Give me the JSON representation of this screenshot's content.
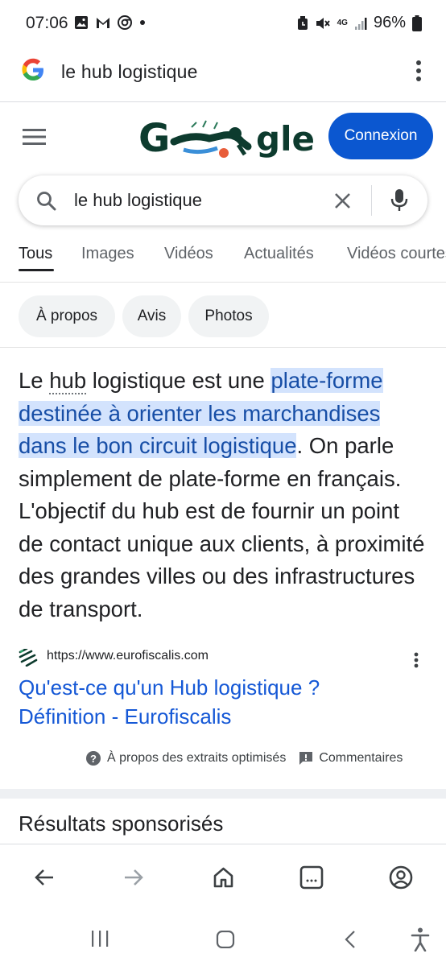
{
  "status": {
    "time": "07:06",
    "battery": "96%",
    "net": "4G"
  },
  "urlbar": {
    "query": "le hub logistique"
  },
  "header": {
    "signin_label": "Connexion",
    "logo_left": "G",
    "logo_right": "gle"
  },
  "search": {
    "value": "le hub logistique"
  },
  "tabs": [
    "Tous",
    "Images",
    "Vidéos",
    "Actualités",
    "Vidéos courtes"
  ],
  "chips": [
    "À propos",
    "Avis",
    "Photos"
  ],
  "snippet": {
    "part1": "Le ",
    "hub": "hub",
    "part2": " logistique est une ",
    "highlight1": "plate-forme",
    "highlight2": "destinée à orienter les marchandises",
    "highlight3": "dans le bon circuit logistique",
    "part3": ". On parle simplement de plate-forme en français. L'objectif du hub est de fournir un point de contact unique aux clients, à proximité des grandes villes ou des infrastructures de transport."
  },
  "source": {
    "url": "https://www.eurofiscalis.com",
    "title_line1": "Qu'est-ce qu'un Hub logistique ?",
    "title_line2": "Définition - Eurofiscalis"
  },
  "footer_links": {
    "about": "À propos des extraits optimisés",
    "feedback": "Commentaires"
  },
  "sponsored": "Résultats sponsorisés",
  "colors": {
    "accent": "#0b57d0",
    "highlight": "#d3e3fd",
    "link": "#1a0dab"
  }
}
